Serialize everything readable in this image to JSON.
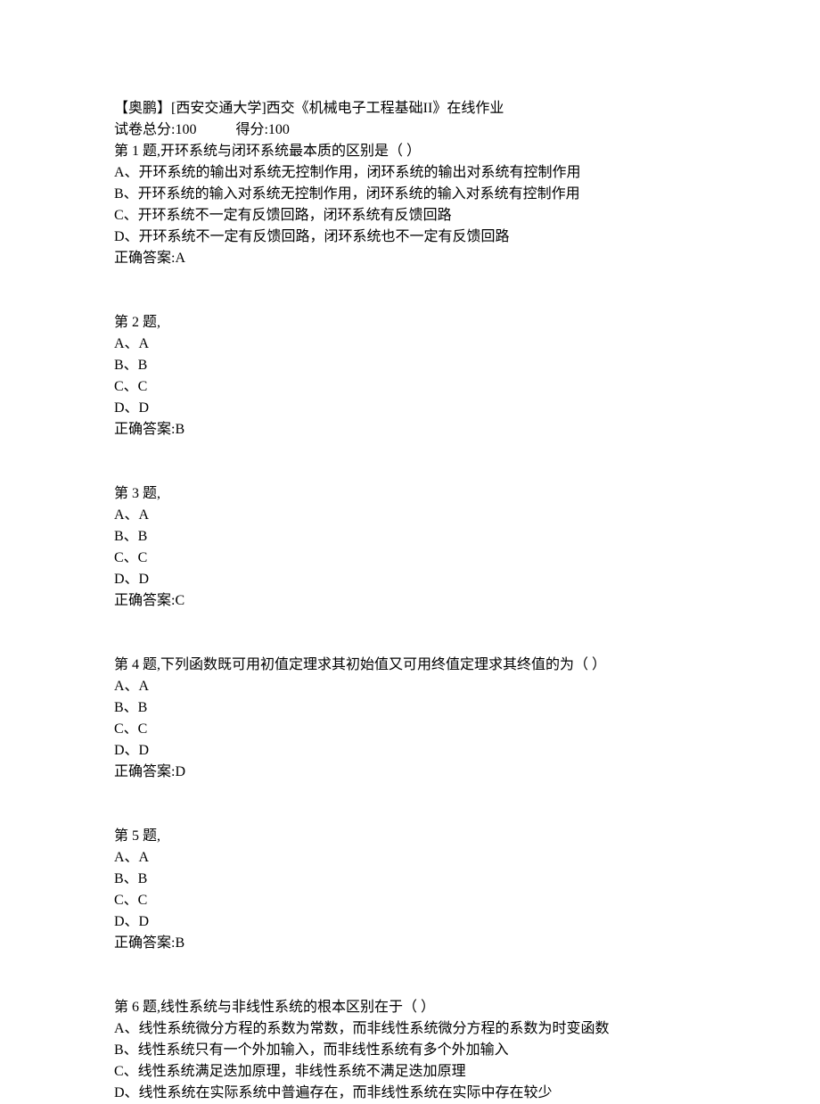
{
  "header": {
    "title": "【奥鹏】[西安交通大学]西交《机械电子工程基础II》在线作业",
    "total_label": "试卷总分:100",
    "score_label": "得分:100"
  },
  "questions": [
    {
      "stem": "第 1 题,开环系统与闭环系统最本质的区别是（      ）",
      "options": [
        "A、开环系统的输出对系统无控制作用，闭环系统的输出对系统有控制作用",
        "B、开环系统的输入对系统无控制作用，闭环系统的输入对系统有控制作用",
        "C、开环系统不一定有反馈回路，闭环系统有反馈回路",
        "D、开环系统不一定有反馈回路，闭环系统也不一定有反馈回路"
      ],
      "answer": "正确答案:A"
    },
    {
      "stem": "第 2 题,",
      "options": [
        "A、A",
        "B、B",
        "C、C",
        "D、D"
      ],
      "answer": "正确答案:B"
    },
    {
      "stem": "第 3 题,",
      "options": [
        "A、A",
        "B、B",
        "C、C",
        "D、D"
      ],
      "answer": "正确答案:C"
    },
    {
      "stem": "第 4 题,下列函数既可用初值定理求其初始值又可用终值定理求其终值的为（      ）",
      "options": [
        "A、A",
        "B、B",
        "C、C",
        "D、D"
      ],
      "answer": "正确答案:D"
    },
    {
      "stem": "第 5 题,",
      "options": [
        "A、A",
        "B、B",
        "C、C",
        "D、D"
      ],
      "answer": "正确答案:B"
    },
    {
      "stem": "第 6 题,线性系统与非线性系统的根本区别在于（      ）",
      "options": [
        "A、线性系统微分方程的系数为常数，而非线性系统微分方程的系数为时变函数",
        "B、线性系统只有一个外加输入，而非线性系统有多个外加输入",
        "C、线性系统满足迭加原理，非线性系统不满足迭加原理",
        "D、线性系统在实际系统中普遍存在，而非线性系统在实际中存在较少"
      ],
      "answer": ""
    }
  ]
}
